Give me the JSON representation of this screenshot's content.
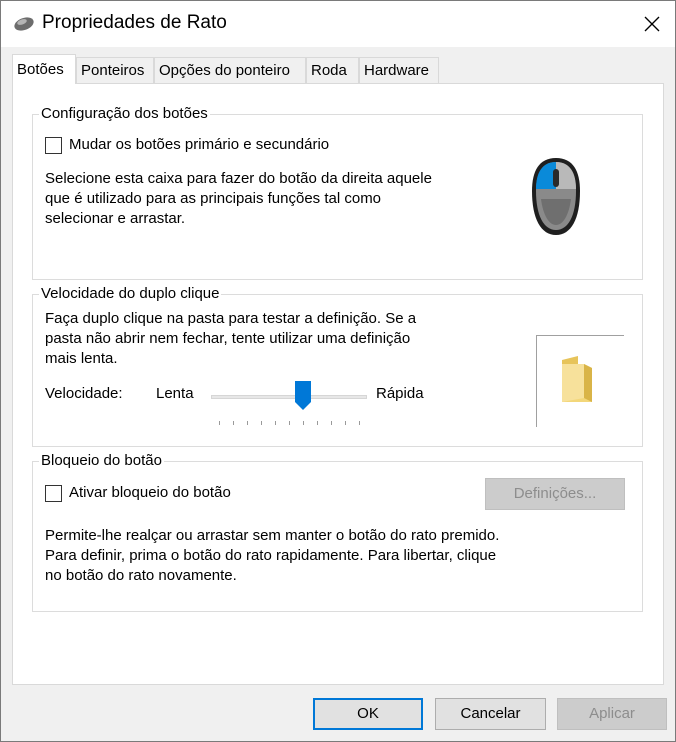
{
  "window": {
    "title": "Propriedades de Rato",
    "icon": "mouse-icon",
    "close_icon": "close-icon"
  },
  "tabs": [
    {
      "label": "Botões",
      "active": true
    },
    {
      "label": "Ponteiros",
      "active": false
    },
    {
      "label": "Opções do ponteiro",
      "active": false
    },
    {
      "label": "Roda",
      "active": false
    },
    {
      "label": "Hardware",
      "active": false
    }
  ],
  "button_config": {
    "title": "Configuração dos botões",
    "checkbox_label": "Mudar os botões primário e secundário",
    "checked": false,
    "description_lines": [
      "Selecione esta caixa para fazer do botão da direita aquele",
      "que é utilizado para as principais funções tal como",
      "selecionar e arrastar."
    ],
    "image": "mouse-left-button-icon"
  },
  "double_click": {
    "title": "Velocidade do duplo clique",
    "description_lines": [
      "Faça duplo clique na pasta para testar a definição. Se a",
      "pasta não abrir nem fechar, tente utilizar uma definição",
      "mais lenta."
    ],
    "speed_label": "Velocidade:",
    "slow_label": "Lenta",
    "fast_label": "Rápida",
    "slider_value": 0.6,
    "tick_count": 11,
    "test_icon": "folder-icon"
  },
  "click_lock": {
    "title": "Bloqueio do botão",
    "checkbox_label": "Ativar bloqueio do botão",
    "checked": false,
    "settings_button": "Definições...",
    "description_lines": [
      "Permite-lhe realçar ou arrastar sem manter o botão do rato premido.",
      "Para definir, prima o botão do rato rapidamente. Para libertar, clique",
      "no botão do rato novamente."
    ]
  },
  "footer": {
    "ok": "OK",
    "cancel": "Cancelar",
    "apply": "Aplicar"
  },
  "colors": {
    "accent": "#0078d7",
    "slider_thumb": "#0078d7"
  }
}
